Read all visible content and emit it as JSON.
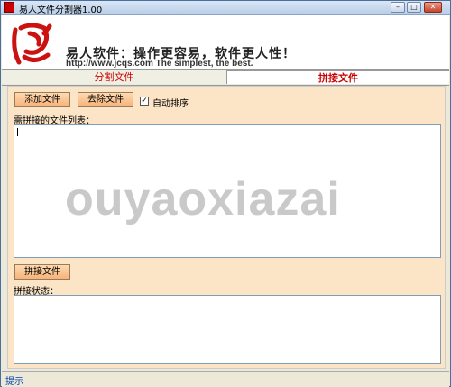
{
  "window": {
    "title": "易人文件分割器1.00",
    "minimize": "–",
    "maximize": "□",
    "close": "✕"
  },
  "banner": {
    "slogan": "易人软件：操作更容易，软件更人性！",
    "url_line": "http://www.jcqs.com   The simplest, the best."
  },
  "tabs": [
    "分割文件",
    "拼接文件"
  ],
  "join": {
    "add_button": "添加文件",
    "remove_button": "去除文件",
    "autosort_label": "自动排序",
    "autosort_checked": true,
    "list_label": "需拼接的文件列表：",
    "join_button": "拼接文件",
    "status_label": "拼接状态："
  },
  "watermark": "ouyaoxiazai",
  "statusbar": {
    "text": "提示"
  },
  "colors": {
    "panel": "#fce4c6",
    "button": "#f7b27a",
    "tab_text": "#cc0000",
    "status_link": "#0645ad"
  }
}
